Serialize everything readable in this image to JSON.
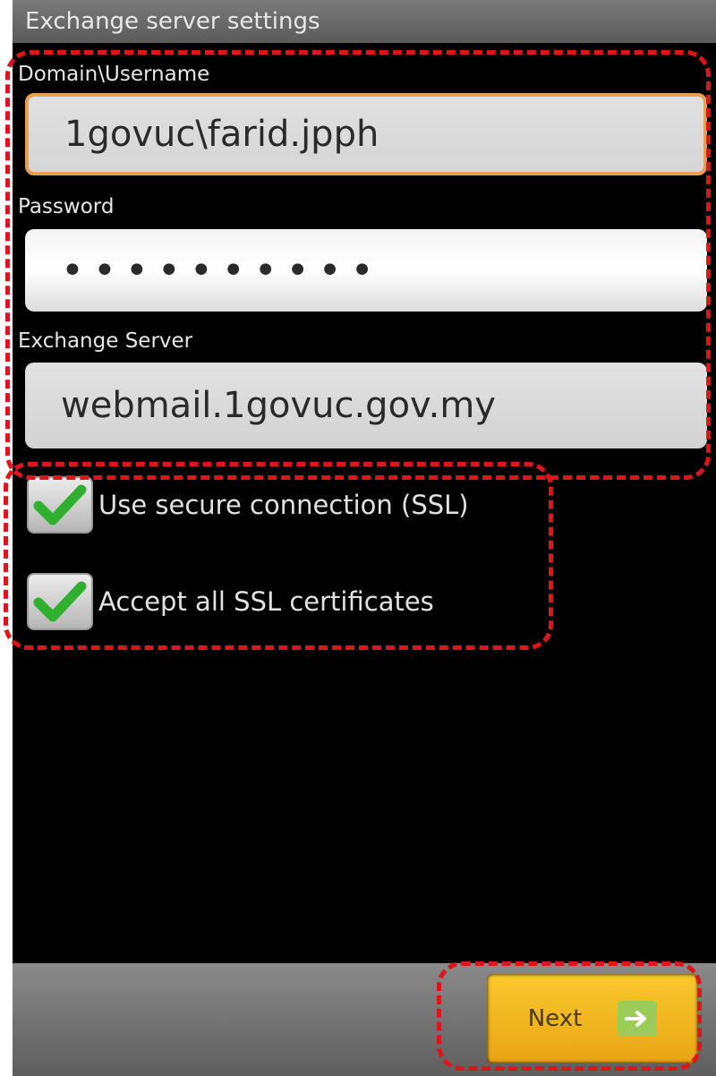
{
  "window": {
    "title": "Exchange server settings"
  },
  "form": {
    "username": {
      "label": "Domain\\Username",
      "value": "1govuc\\farid.jpph"
    },
    "password": {
      "label": "Password",
      "value": "••••••••••"
    },
    "server": {
      "label": "Exchange Server",
      "value": "webmail.1govuc.gov.my"
    }
  },
  "options": {
    "ssl": {
      "label": "Use secure connection (SSL)",
      "checked": true
    },
    "accept_certs": {
      "label": "Accept all SSL certificates",
      "checked": true
    }
  },
  "footer": {
    "next_label": "Next"
  },
  "colors": {
    "highlight": "#e0151a",
    "next_button": "#f5bb22",
    "check": "#2fb02f"
  }
}
